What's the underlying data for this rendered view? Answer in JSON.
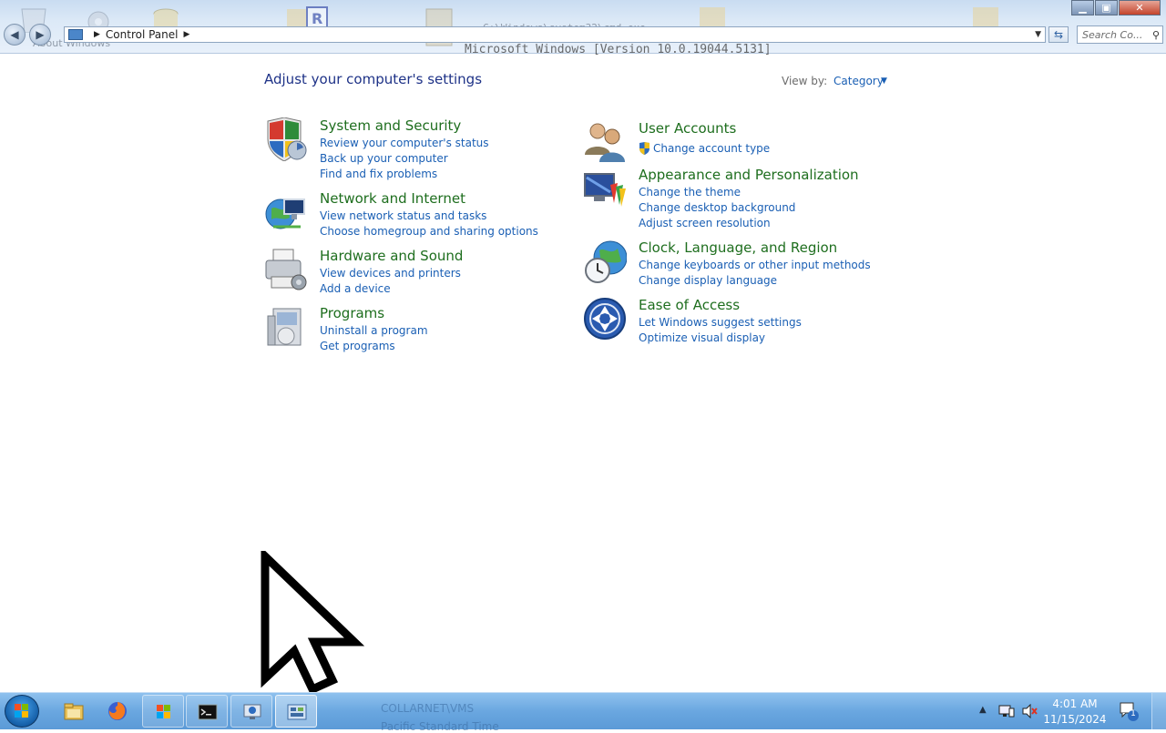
{
  "window": {
    "address_root": "Control Panel",
    "search_placeholder": "Search Co...",
    "ghost_path": "C:\\Windows\\system32\\cmd.exe",
    "ghost_console": "Microsoft Windows [Version 10.0.19044.5131]",
    "ghost_about": "About Windows"
  },
  "header": {
    "title": "Adjust your computer's settings",
    "view_by_label": "View by:",
    "view_by_value": "Category"
  },
  "categories": [
    {
      "name": "System and Security",
      "icon": "shield-icon",
      "links": [
        "Review your computer's status",
        "Back up your computer",
        "Find and fix problems"
      ]
    },
    {
      "name": "Network and Internet",
      "icon": "globe-network-icon",
      "links": [
        "View network status and tasks",
        "Choose homegroup and sharing options"
      ]
    },
    {
      "name": "Hardware and Sound",
      "icon": "printer-icon",
      "links": [
        "View devices and printers",
        "Add a device"
      ]
    },
    {
      "name": "Programs",
      "icon": "programs-box-icon",
      "links": [
        "Uninstall a program",
        "Get programs"
      ]
    },
    {
      "name": "User Accounts",
      "icon": "users-icon",
      "links": [
        "Change account type"
      ]
    },
    {
      "name": "Appearance and Personalization",
      "icon": "monitor-paint-icon",
      "links": [
        "Change the theme",
        "Change desktop background",
        "Adjust screen resolution"
      ]
    },
    {
      "name": "Clock, Language, and Region",
      "icon": "clock-globe-icon",
      "links": [
        "Change keyboards or other input methods",
        "Change display language"
      ]
    },
    {
      "name": "Ease of Access",
      "icon": "ease-of-access-icon",
      "links": [
        "Let Windows suggest settings",
        "Optimize visual display"
      ]
    }
  ],
  "taskbar": {
    "ghost_host": "COLLARNET\\VMS",
    "ghost_tz": "Pacific Standard Time",
    "time": "4:01 AM",
    "date": "11/15/2024",
    "notification_count": "1"
  },
  "colors": {
    "heading_green": "#1e6e1e",
    "link_blue": "#1a5fb4",
    "title_blue": "#1e3287"
  }
}
